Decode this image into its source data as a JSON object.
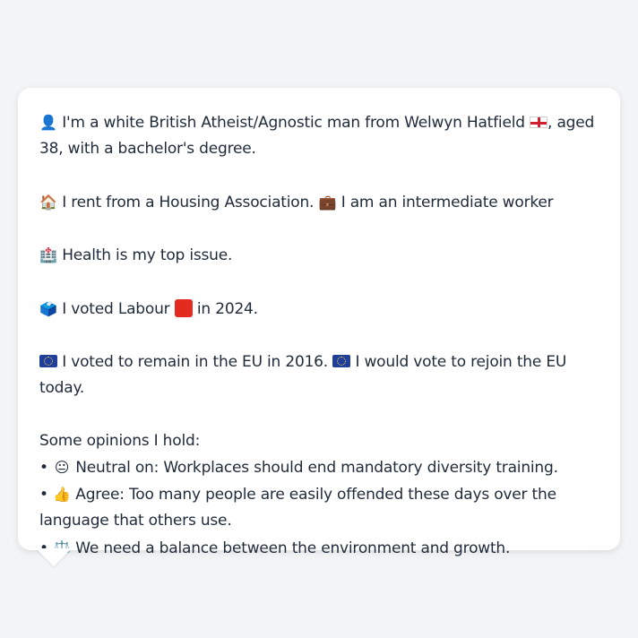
{
  "persona": {
    "line1_pre": "I'm a white British Atheist/Agnostic man from Welwyn Hatfield",
    "line1_post": ", aged 38, with a bachelor's degree.",
    "line2_a": "I rent from a Housing Association.",
    "line2_b": "I am an intermediate worker",
    "line3": "Health is my top issue.",
    "line4_pre": "I voted Labour",
    "line4_post": "in 2024.",
    "line5_a": "I voted to remain in the EU in 2016.",
    "line5_b": "I would vote to rejoin the EU today.",
    "opinions_heading": "Some opinions I hold:",
    "opinions": [
      {
        "bullet": "•",
        "emoji": "😐",
        "text": "Neutral on: Workplaces should end mandatory diversity training."
      },
      {
        "bullet": "•",
        "emoji": "👍",
        "text": "Agree: Too many people are easily offended these days over the language that others use."
      },
      {
        "bullet": "•",
        "emoji": "⚖️",
        "text": "We need a balance between the environment and growth."
      }
    ]
  },
  "icons": {
    "person": "👤",
    "house": "🏠",
    "briefcase": "💼",
    "hospital": "🏥",
    "ballot": "🗳️"
  }
}
